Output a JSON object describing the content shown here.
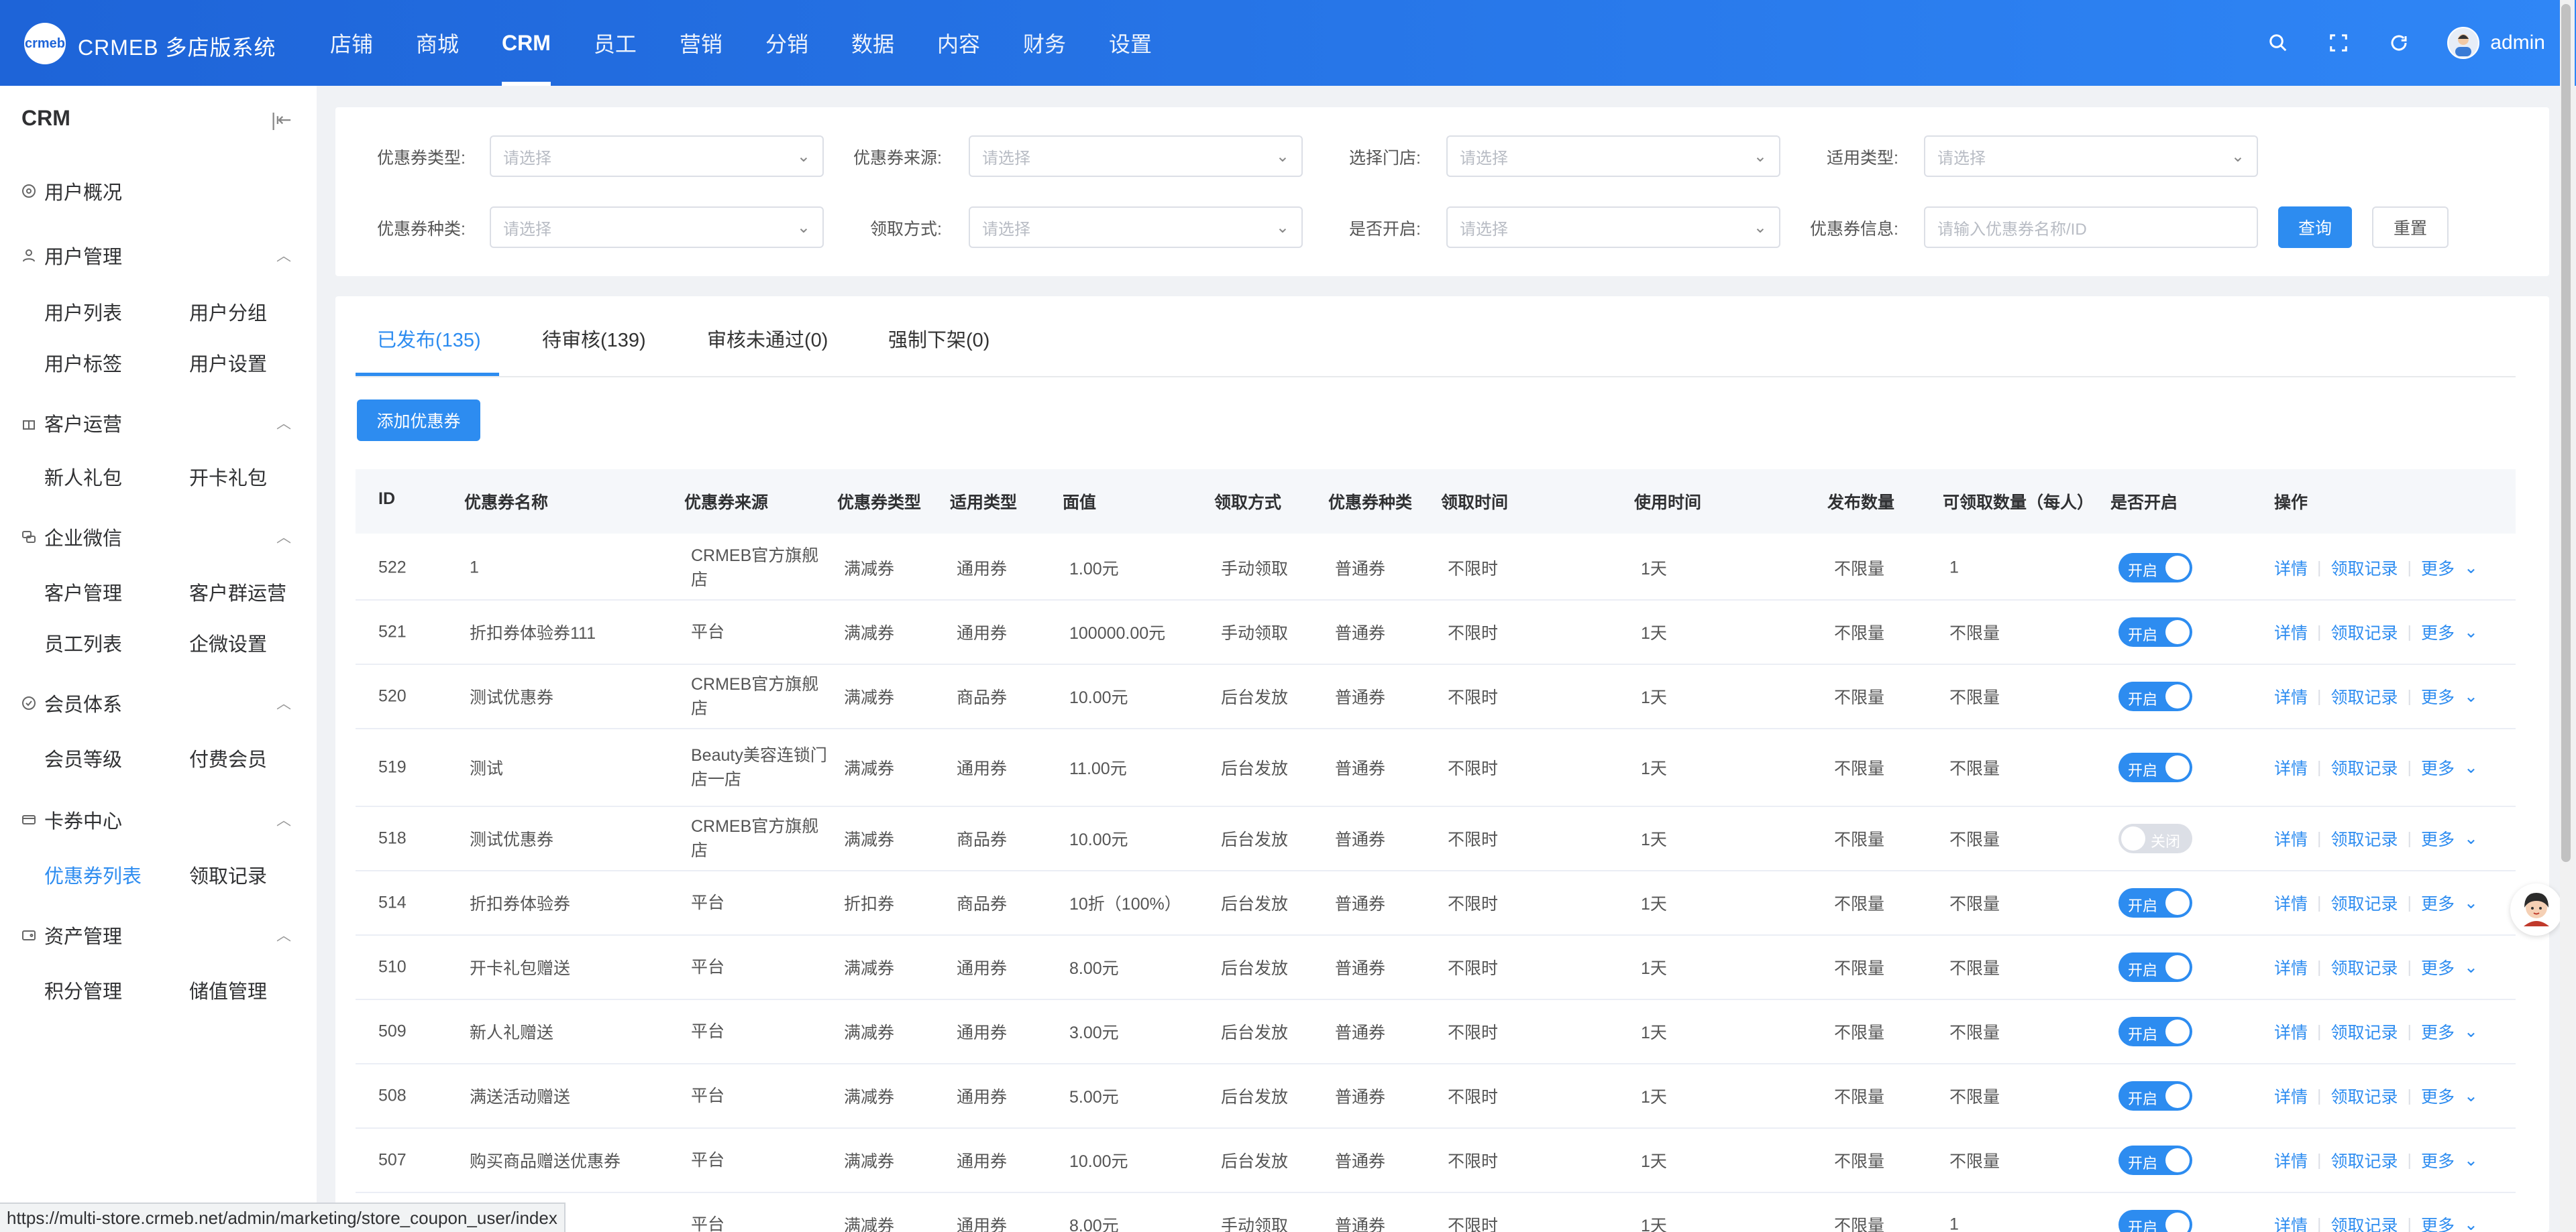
{
  "header": {
    "logo_text": "crmeb",
    "brand": "CRMEB 多店版系统",
    "nav": [
      "店铺",
      "商城",
      "CRM",
      "员工",
      "营销",
      "分销",
      "数据",
      "内容",
      "财务",
      "设置"
    ],
    "active_nav": "CRM",
    "username": "admin",
    "icons": [
      "search-icon",
      "fullscreen-icon",
      "refresh-icon"
    ]
  },
  "sidebar": {
    "title": "CRM",
    "groups": [
      {
        "label": "用户概况",
        "icon": "dashboard-icon",
        "items": []
      },
      {
        "label": "用户管理",
        "icon": "user-icon",
        "items": [
          "用户列表",
          "用户分组",
          "用户标签",
          "用户设置"
        ]
      },
      {
        "label": "客户运营",
        "icon": "gift-icon",
        "items": [
          "新人礼包",
          "开卡礼包"
        ]
      },
      {
        "label": "企业微信",
        "icon": "wechat-icon",
        "items": [
          "客户管理",
          "客户群运营",
          "员工列表",
          "企微设置"
        ]
      },
      {
        "label": "会员体系",
        "icon": "member-icon",
        "items": [
          "会员等级",
          "付费会员"
        ]
      },
      {
        "label": "卡券中心",
        "icon": "card-icon",
        "items": [
          "优惠券列表",
          "领取记录"
        ]
      },
      {
        "label": "资产管理",
        "icon": "wallet-icon",
        "items": [
          "积分管理",
          "储值管理"
        ]
      }
    ],
    "active_item": "优惠券列表"
  },
  "filters": {
    "coupon_type_label": "优惠券类型:",
    "coupon_source_label": "优惠券来源:",
    "store_label": "选择门店:",
    "apply_type_label": "适用类型:",
    "coupon_kind_label": "优惠券种类:",
    "receive_method_label": "领取方式:",
    "enabled_label": "是否开启:",
    "coupon_info_label": "优惠券信息:",
    "select_placeholder": "请选择",
    "info_placeholder": "请输入优惠券名称/ID",
    "query_button": "查询",
    "reset_button": "重置"
  },
  "tabs": [
    "已发布(135)",
    "待审核(139)",
    "审核未通过(0)",
    "强制下架(0)"
  ],
  "add_button": "添加优惠券",
  "table": {
    "columns": [
      "ID",
      "优惠券名称",
      "优惠券来源",
      "优惠券类型",
      "适用类型",
      "面值",
      "领取方式",
      "优惠券种类",
      "领取时间",
      "使用时间",
      "发布数量",
      "可领取数量（每人）",
      "是否开启",
      "操作"
    ],
    "rows": [
      {
        "id": "522",
        "name": "1",
        "source": "CRMEB官方旗舰店",
        "type": "满减券",
        "apply": "通用券",
        "value": "1.00元",
        "method": "手动领取",
        "kind": "普通券",
        "receive_time": "不限时",
        "use_time": "1天",
        "total": "不限量",
        "per_user": "1",
        "enabled": true
      },
      {
        "id": "521",
        "name": "折扣券体验券111",
        "source": "平台",
        "type": "满减券",
        "apply": "通用券",
        "value": "100000.00元",
        "method": "手动领取",
        "kind": "普通券",
        "receive_time": "不限时",
        "use_time": "1天",
        "total": "不限量",
        "per_user": "不限量",
        "enabled": true
      },
      {
        "id": "520",
        "name": "测试优惠券",
        "source": "CRMEB官方旗舰店",
        "type": "满减券",
        "apply": "商品券",
        "value": "10.00元",
        "method": "后台发放",
        "kind": "普通券",
        "receive_time": "不限时",
        "use_time": "1天",
        "total": "不限量",
        "per_user": "不限量",
        "enabled": true
      },
      {
        "id": "519",
        "name": "测试",
        "source": "Beauty美容连锁门店一店",
        "type": "满减券",
        "apply": "通用券",
        "value": "11.00元",
        "method": "后台发放",
        "kind": "普通券",
        "receive_time": "不限时",
        "use_time": "1天",
        "total": "不限量",
        "per_user": "不限量",
        "enabled": true
      },
      {
        "id": "518",
        "name": "测试优惠券",
        "source": "CRMEB官方旗舰店",
        "type": "满减券",
        "apply": "商品券",
        "value": "10.00元",
        "method": "后台发放",
        "kind": "普通券",
        "receive_time": "不限时",
        "use_time": "1天",
        "total": "不限量",
        "per_user": "不限量",
        "enabled": false
      },
      {
        "id": "514",
        "name": "折扣券体验券",
        "source": "平台",
        "type": "折扣券",
        "apply": "商品券",
        "value": "10折（100%）",
        "method": "后台发放",
        "kind": "普通券",
        "receive_time": "不限时",
        "use_time": "1天",
        "total": "不限量",
        "per_user": "不限量",
        "enabled": true
      },
      {
        "id": "510",
        "name": "开卡礼包赠送",
        "source": "平台",
        "type": "满减券",
        "apply": "通用券",
        "value": "8.00元",
        "method": "后台发放",
        "kind": "普通券",
        "receive_time": "不限时",
        "use_time": "1天",
        "total": "不限量",
        "per_user": "不限量",
        "enabled": true
      },
      {
        "id": "509",
        "name": "新人礼赠送",
        "source": "平台",
        "type": "满减券",
        "apply": "通用券",
        "value": "3.00元",
        "method": "后台发放",
        "kind": "普通券",
        "receive_time": "不限时",
        "use_time": "1天",
        "total": "不限量",
        "per_user": "不限量",
        "enabled": true
      },
      {
        "id": "508",
        "name": "满送活动赠送",
        "source": "平台",
        "type": "满减券",
        "apply": "通用券",
        "value": "5.00元",
        "method": "后台发放",
        "kind": "普通券",
        "receive_time": "不限时",
        "use_time": "1天",
        "total": "不限量",
        "per_user": "不限量",
        "enabled": true
      },
      {
        "id": "507",
        "name": "购买商品赠送优惠券",
        "source": "平台",
        "type": "满减券",
        "apply": "通用券",
        "value": "10.00元",
        "method": "后台发放",
        "kind": "普通券",
        "receive_time": "不限时",
        "use_time": "1天",
        "total": "不限量",
        "per_user": "不限量",
        "enabled": true
      },
      {
        "id": "",
        "name": "",
        "source": "平台",
        "type": "满减券",
        "apply": "通用券",
        "value": "8.00元",
        "method": "手动领取",
        "kind": "普通券",
        "receive_time": "不限时",
        "use_time": "1天",
        "total": "不限量",
        "per_user": "1",
        "enabled": true
      }
    ],
    "switch_on": "开启",
    "switch_off": "关闭",
    "actions": [
      "详情",
      "领取记录",
      "更多"
    ]
  },
  "status_url": "https://multi-store.crmeb.net/admin/marketing/store_coupon_user/index",
  "colors": {
    "primary": "#2d8cf0",
    "header_start": "#1e64d8",
    "header_end": "#2f86f6"
  }
}
